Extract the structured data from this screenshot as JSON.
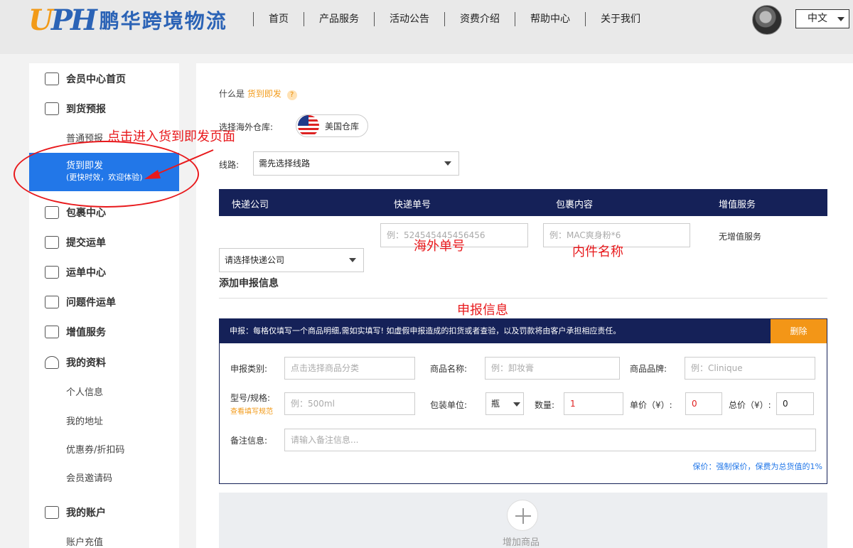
{
  "brand": {
    "logo_mark": "UPH",
    "name": "鹏华跨境物流"
  },
  "nav": [
    "首页",
    "产品服务",
    "活动公告",
    "资费介绍",
    "帮助中心",
    "关于我们"
  ],
  "lang": "中文",
  "sidebar": {
    "member_home": "会员中心首页",
    "arrival_forecast": "到货预报",
    "normal_forecast": "普通预报",
    "fast_ship": "货到即发",
    "fast_ship_sub": "(更快时效，欢迎体验)",
    "parcel_center": "包裹中心",
    "submit_waybill": "提交运单",
    "waybill_center": "运单中心",
    "problem_waybill": "问题件运单",
    "value_added": "增值服务",
    "my_profile": "我的资料",
    "personal_info": "个人信息",
    "my_address": "我的地址",
    "coupons": "优惠券/折扣码",
    "invite_code": "会员邀请码",
    "my_account": "我的账户",
    "recharge": "账户充值"
  },
  "main": {
    "what_is": "什么是",
    "what_is_link": "货到即发",
    "help_mark": "?",
    "warehouse_label": "选择海外仓库:",
    "warehouse_name": "美国仓库",
    "route_label": "线路:",
    "route_select": "需先选择线路",
    "table_headers": [
      "快递公司",
      "快递单号",
      "包裹内容",
      "增值服务"
    ],
    "courier_select": "请选择快递公司",
    "tracking_placeholder": "例：524545445456456",
    "content_placeholder": "例：MAC爽身粉*6",
    "value_added_text": "无增值服务",
    "add_declare_title": "添加申报信息",
    "declare_notice": "申报：每格仅填写一个商品明细,需如实填写! 如虚假申报造成的扣货或者查验，以及罚款将由客户承担相应责任。",
    "delete_btn": "删除",
    "fields": {
      "category_label": "申报类别:",
      "category_placeholder": "点击选择商品分类",
      "product_name_label": "商品名称:",
      "product_name_placeholder": "例：卸妆膏",
      "brand_label": "商品品牌:",
      "brand_placeholder": "例：Clinique",
      "model_label": "型号/规格:",
      "model_link": "查看填写规范",
      "model_placeholder": "例：500ml",
      "pack_unit_label": "包装单位:",
      "pack_unit_value": "瓶",
      "qty_label": "数量:",
      "qty_value": "1",
      "unit_price_label": "单价（¥）:",
      "unit_price_value": "0",
      "total_price_label": "总价（¥）:",
      "total_price_value": "0",
      "remark_label": "备注信息:",
      "remark_placeholder": "请输入备注信息..."
    },
    "insurance_note": "保价：强制保价，保费为总货值的1%",
    "add_product": "增加商品"
  },
  "annotations": {
    "click_enter": "点击进入货到即发页面",
    "overseas_no": "海外单号",
    "item_name": "内件名称",
    "declare_info": "申报信息"
  },
  "colors": {
    "brand_blue": "#2b63b6",
    "brand_orange": "#f29a18",
    "navy": "#152158",
    "active_blue": "#2277e8",
    "annotation_red": "#e8191c"
  }
}
